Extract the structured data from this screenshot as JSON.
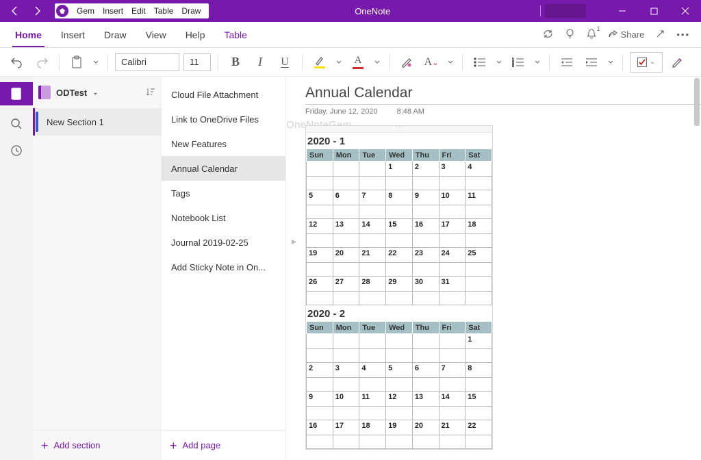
{
  "app_title": "OneNote",
  "gem_menu": {
    "items": [
      "Gem",
      "Insert",
      "Edit",
      "Table",
      "Draw"
    ]
  },
  "ribbon": {
    "tabs": [
      "Home",
      "Insert",
      "Draw",
      "View",
      "Help",
      "Table"
    ],
    "active": "Home",
    "share_label": "Share",
    "notification_count": "1"
  },
  "toolbar": {
    "font_name": "Calibri",
    "font_size": "11",
    "highlight_color": "#ffe600",
    "font_color": "#d12b2b"
  },
  "notebook": {
    "name": "ODTest"
  },
  "sections": {
    "items": [
      "New Section 1"
    ],
    "active": 0,
    "add_label": "Add section"
  },
  "pages": {
    "items": [
      "Cloud File Attachment",
      "Link to OneDrive Files",
      "New Features",
      "Annual Calendar",
      "Tags",
      "Notebook List",
      "Journal 2019-02-25",
      "Add Sticky Note in On..."
    ],
    "active": 3,
    "add_label": "Add page"
  },
  "page": {
    "title": "Annual Calendar",
    "date": "Friday, June 12, 2020",
    "time": "8:48 AM"
  },
  "watermark": "OneNoteGem",
  "calendar": {
    "day_headers": [
      "Sun",
      "Mon",
      "Tue",
      "Wed",
      "Thu",
      "Fri",
      "Sat"
    ],
    "months": [
      {
        "title": "2020 - 1",
        "weeks": [
          [
            "",
            "",
            "",
            "1",
            "2",
            "3",
            "4"
          ],
          [
            "5",
            "6",
            "7",
            "8",
            "9",
            "10",
            "11"
          ],
          [
            "12",
            "13",
            "14",
            "15",
            "16",
            "17",
            "18"
          ],
          [
            "19",
            "20",
            "21",
            "22",
            "23",
            "24",
            "25"
          ],
          [
            "26",
            "27",
            "28",
            "29",
            "30",
            "31",
            ""
          ]
        ]
      },
      {
        "title": "2020 - 2",
        "weeks": [
          [
            "",
            "",
            "",
            "",
            "",
            "",
            "1"
          ],
          [
            "2",
            "3",
            "4",
            "5",
            "6",
            "7",
            "8"
          ],
          [
            "9",
            "10",
            "11",
            "12",
            "13",
            "14",
            "15"
          ],
          [
            "16",
            "17",
            "18",
            "19",
            "20",
            "21",
            "22"
          ]
        ]
      }
    ]
  }
}
